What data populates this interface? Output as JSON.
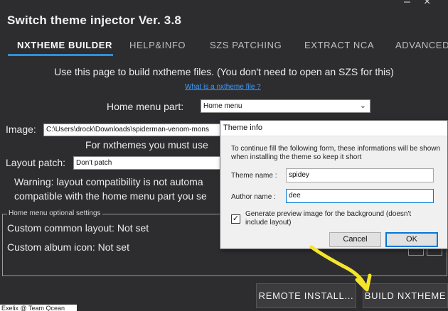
{
  "window": {
    "title": "Switch theme injector Ver. 3.8",
    "minimize_glyph": "–",
    "close_glyph": "×"
  },
  "tabs": [
    {
      "label": "NXTHEME BUILDER",
      "active": true
    },
    {
      "label": "HELP&INFO",
      "active": false
    },
    {
      "label": "SZS PATCHING",
      "active": false
    },
    {
      "label": "EXTRACT NCA",
      "active": false
    },
    {
      "label": "ADVANCED",
      "active": false
    }
  ],
  "builder": {
    "intro": "Use this page to build nxtheme files. (You don't need to open an SZS for this)",
    "info_link": "What is a nxtheme file ?",
    "home_menu_part_label": "Home menu part:",
    "home_menu_part_value": "Home menu",
    "image_label": "Image:",
    "image_path": "C:\\Users\\drock\\Downloads\\spiderman-venom-mons",
    "for_nxthemes_text": "For nxthemes you must use",
    "layout_patch_label": "Layout patch:",
    "layout_patch_value": "Don't patch",
    "warning_line1": "Warning: layout compatibility is not automa",
    "warning_line2": "compatible with the home menu part you se",
    "optional_group_title": "Home menu optional settings",
    "custom_common_layout": "Custom common layout: Not set",
    "custom_album_icon": "Custom album icon: Not set"
  },
  "buttons": {
    "remote_install": "REMOTE INSTALL...",
    "build_nxtheme": "BUILD NXTHEME"
  },
  "credit": "Exelix @ Team Qcean",
  "dialog": {
    "title": "Theme info",
    "text": "To continue fill the following form, these informations will be shown when installing the theme so keep it short",
    "theme_name_label": "Theme name :",
    "theme_name_value": "spidey",
    "author_name_label": "Author name :",
    "author_name_value": "dee",
    "checkbox_checked": true,
    "checkbox_label": "Generate preview image for the background (doesn't include layout)",
    "cancel_label": "Cancel",
    "ok_label": "OK"
  },
  "icons": {
    "combo_chevron": "chevron-down-icon",
    "check": "checkmark-icon",
    "annotation": "yellow-arrow-annotation"
  },
  "colors": {
    "background": "#2d2d30",
    "accent": "#2f8fd8",
    "link": "#3b9cff",
    "annotation": "#f5e52a"
  }
}
